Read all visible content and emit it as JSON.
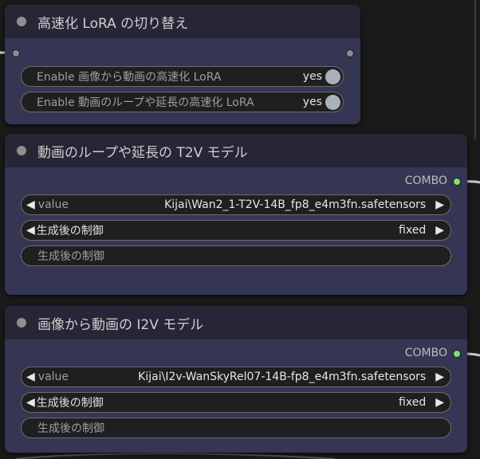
{
  "nodes": [
    {
      "title": "高速化 LoRA の切り替え",
      "toggles": [
        {
          "label": "Enable 画像から動画の高速化 LoRA",
          "value": "yes"
        },
        {
          "label": "Enable 動画のループや延長の高速化 LoRA",
          "value": "yes"
        }
      ]
    },
    {
      "title": "動画のループや延長の T2V モデル",
      "output_label": "COMBO",
      "value_label": "value",
      "value": "Kijai\\Wan2_1-T2V-14B_fp8_e4m3fn.safetensors",
      "control_label": "生成後の制御",
      "control_value": "fixed",
      "text_label": "生成後の制御"
    },
    {
      "title": "画像から動画の I2V モデル",
      "output_label": "COMBO",
      "value_label": "value",
      "value": "Kijai\\I2v-WanSkyRel07-14B-fp8_e4m3fn.safetensors",
      "control_label": "生成後の制御",
      "control_value": "fixed",
      "text_label": "生成後の制御"
    }
  ],
  "icons": {
    "arrow_left": "◀",
    "arrow_right": "▶"
  },
  "colors": {
    "node_body": "#353554",
    "node_header": "#262637",
    "output_connected": "#7ee07e",
    "wire": "#c8c8c8"
  }
}
